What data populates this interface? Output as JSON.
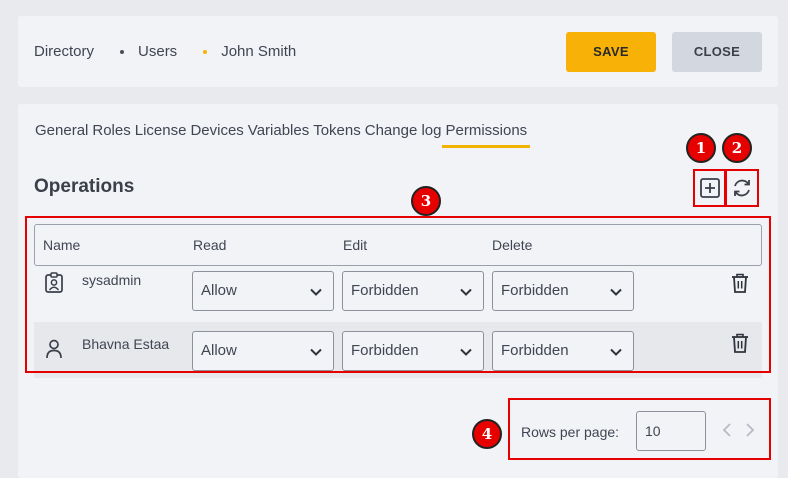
{
  "breadcrumb": [
    "Directory",
    "Users",
    "John Smith"
  ],
  "header": {
    "save_label": "SAVE",
    "close_label": "CLOSE"
  },
  "tabs": [
    "General",
    "Roles",
    "License",
    "Devices",
    "Variables",
    "Tokens",
    "Change log",
    "Permissions"
  ],
  "active_tab": "Permissions",
  "section": {
    "title": "Operations",
    "add_icon": "add-square-icon",
    "refresh_icon": "refresh-icon"
  },
  "table": {
    "headers": {
      "name": "Name",
      "read": "Read",
      "edit": "Edit",
      "delete": "Delete"
    },
    "rows": [
      {
        "icon": "badge-user-icon",
        "name": "sysadmin",
        "read": "Allow",
        "edit": "Forbidden",
        "delete": "Forbidden"
      },
      {
        "icon": "person-icon",
        "name": "Bhavna Estaa",
        "read": "Allow",
        "edit": "Forbidden",
        "delete": "Forbidden"
      }
    ]
  },
  "pagination": {
    "label": "Rows per page:",
    "value": "10"
  },
  "markers": [
    "1",
    "2",
    "3",
    "4"
  ],
  "colors": {
    "accent": "#f7b107",
    "annotation": "#e60000"
  }
}
